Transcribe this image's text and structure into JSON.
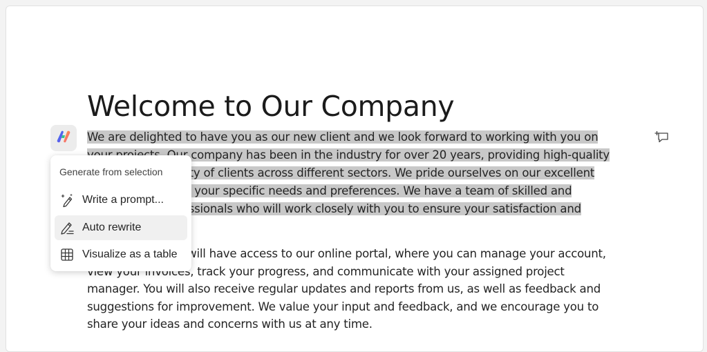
{
  "document": {
    "title": "Welcome to Our Company",
    "paragraph1": "We are delighted to have you as our new client and we look forward to working with you on your projects. Our company has been in the industry for over 20 years, providing high-quality services to a variety of clients across different sectors. We pride ourselves on our excellent service, tailored to your specific needs and preferences. We have a team of skilled and experienced professionals who will work closely with you to ensure your satisfaction and success.",
    "paragraph2": "As our client, you will have access to our online portal, where you can manage your account, view your invoices, track your progress, and communicate with your assigned project manager. You will also receive regular updates and reports from us, as well as feedback and suggestions for improvement. We value your input and feedback, and we encourage you to share your ideas and concerns with us at any time."
  },
  "copilot_menu": {
    "header": "Generate from selection",
    "items": [
      {
        "label": "Write a prompt...",
        "icon": "sparkle-pen-icon"
      },
      {
        "label": "Auto rewrite",
        "icon": "pen-rewrite-icon"
      },
      {
        "label": "Visualize as a table",
        "icon": "table-icon"
      }
    ]
  },
  "icons": {
    "copilot": "copilot-icon",
    "comment": "add-comment-icon"
  },
  "colors": {
    "selection": "#c8c8c8",
    "hover": "#f0f0f0",
    "text": "#242424"
  }
}
